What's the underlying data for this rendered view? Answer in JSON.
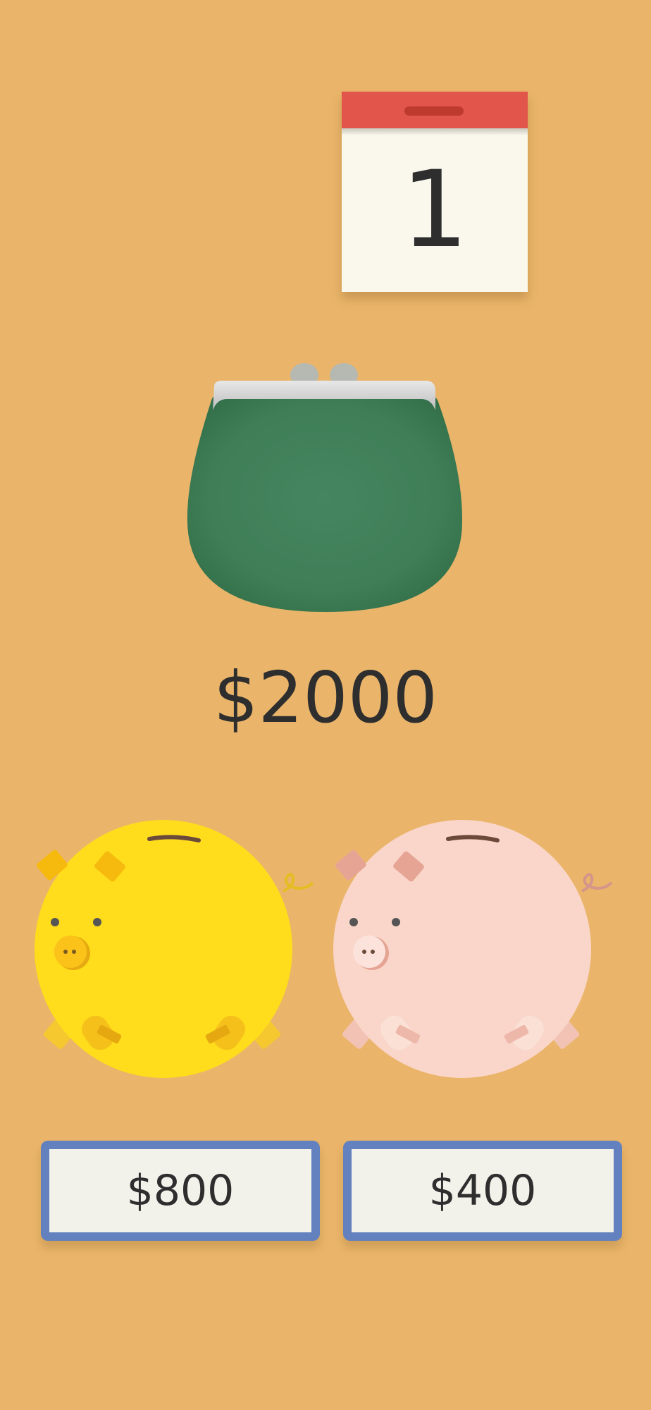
{
  "calendar": {
    "day": "1"
  },
  "wallet": {
    "amount": "$2000"
  },
  "pigs": [
    {
      "color": "yellow",
      "button_label": "$800"
    },
    {
      "color": "pink",
      "button_label": "$400"
    }
  ],
  "colors": {
    "background": "#EAB56A",
    "calendar_header": "#E1554A",
    "purse": "#3F7E57",
    "pig_yellow": "#FFDC1C",
    "pig_pink": "#FAD6CA",
    "button_border": "#6281BE",
    "button_fill": "#F2F1EA"
  }
}
